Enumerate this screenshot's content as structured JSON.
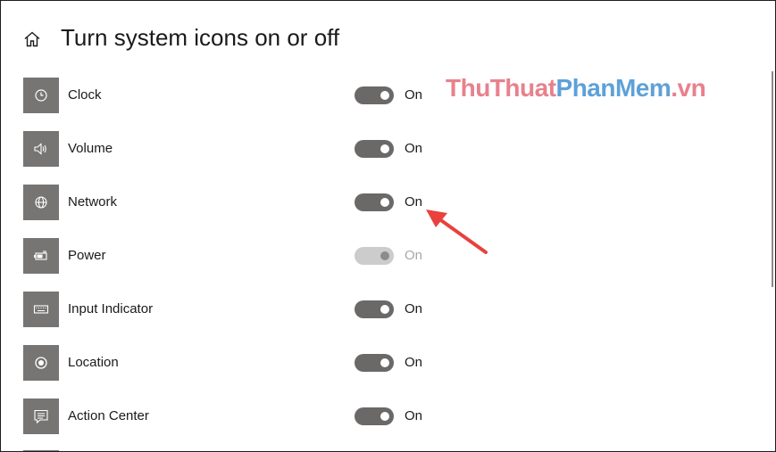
{
  "header": {
    "home_icon": "home-icon",
    "title": "Turn system icons on or off"
  },
  "watermark": {
    "part1": "ThuThuat",
    "part2": "PhanMem",
    "part3": ".vn"
  },
  "rows": [
    {
      "label": "Clock",
      "icon": "clock-icon",
      "state": "On",
      "enabled": true
    },
    {
      "label": "Volume",
      "icon": "speaker-icon",
      "state": "On",
      "enabled": true
    },
    {
      "label": "Network",
      "icon": "globe-icon",
      "state": "On",
      "enabled": true
    },
    {
      "label": "Power",
      "icon": "battery-icon",
      "state": "On",
      "enabled": false
    },
    {
      "label": "Input Indicator",
      "icon": "keyboard-icon",
      "state": "On",
      "enabled": true
    },
    {
      "label": "Location",
      "icon": "location-icon",
      "state": "On",
      "enabled": true
    },
    {
      "label": "Action Center",
      "icon": "action-center-icon",
      "state": "On",
      "enabled": true
    }
  ],
  "colors": {
    "tile": "#777474",
    "toggle_on": "#6b6868",
    "toggle_disabled": "#cccccc",
    "arrow": "#e8413e",
    "watermark_pink": "#e8818d",
    "watermark_blue": "#5ea1d8"
  }
}
